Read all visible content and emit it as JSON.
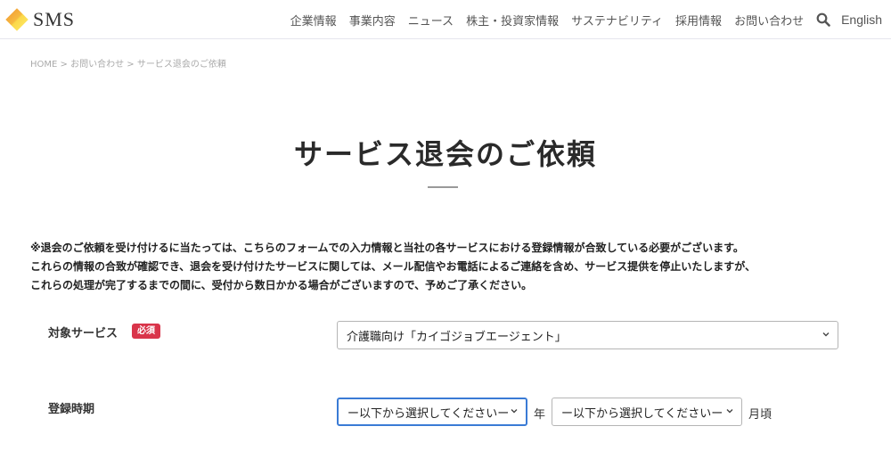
{
  "header": {
    "logo_text": "SMS",
    "nav": [
      "企業情報",
      "事業内容",
      "ニュース",
      "株主・投資家情報",
      "サステナビリティ",
      "採用情報",
      "お問い合わせ"
    ],
    "search_icon": "search-icon",
    "language_link": "English"
  },
  "breadcrumb": {
    "items": [
      "HOME",
      "お問い合わせ",
      "サービス退会のご依頼"
    ],
    "separator": ">"
  },
  "page": {
    "title": "サービス退会のご依頼",
    "notice_lines": [
      "※退会のご依頼を受け付けるに当たっては、こちらのフォームでの入力情報と当社の各サービスにおける登録情報が合致している必要がございます。",
      "これらの情報の合致が確認でき、退会を受け付けたサービスに関しては、メール配信やお電話によるご連絡を含め、サービス提供を停止いたしますが、",
      "これらの処理が完了するまでの間に、受付から数日かかる場合がございますので、予めご了承ください。"
    ]
  },
  "form": {
    "service": {
      "label": "対象サービス",
      "required_badge": "必須",
      "selected": "介護職向け「カイゴジョブエージェント」"
    },
    "registration_period": {
      "label": "登録時期",
      "year_select": "ー以下から選択してくださいー",
      "year_unit": "年",
      "month_select": "ー以下から選択してくださいー",
      "month_unit": "月頃"
    }
  },
  "colors": {
    "required_badge": "#d9344a",
    "focus_border": "#3a7bd5",
    "logo_orange": "#f4a83a",
    "logo_yellow": "#fde25a"
  }
}
